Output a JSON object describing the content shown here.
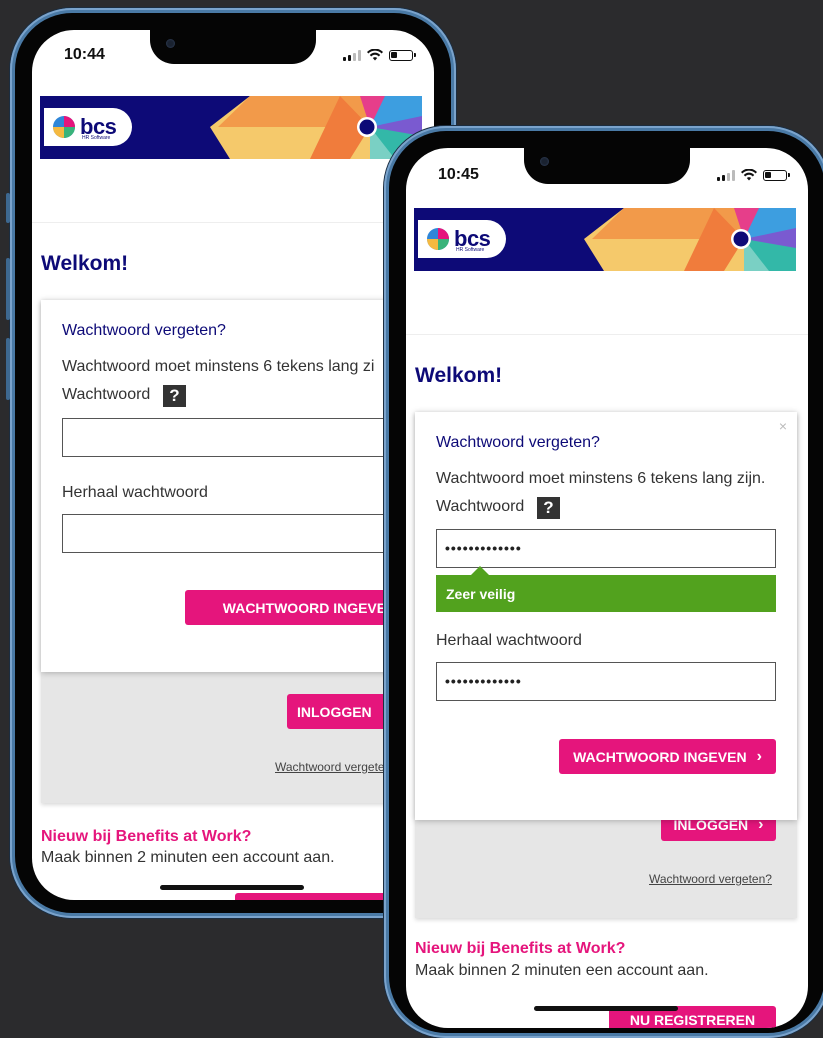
{
  "phone_left": {
    "time": "10:44",
    "welcome": "Welkom!",
    "modal": {
      "forgot_link": "Wachtwoord vergeten?",
      "requirement": "Wachtwoord moet minstens 6 tekens lang zi",
      "password_label": "Wachtwoord",
      "help_icon": "?",
      "password_value": "",
      "repeat_label": "Herhaal wachtwoord",
      "repeat_value": "",
      "submit_label": "WACHTWOORD INGEVEN"
    },
    "login_button": "INLOGGEN",
    "forgot_link_below": "Wachtwoord vergete",
    "new_title": "Nieuw bij Benefits at Work?",
    "new_text": "Maak binnen 2 minuten een account aan."
  },
  "phone_right": {
    "time": "10:45",
    "welcome": "Welkom!",
    "modal": {
      "close_icon": "×",
      "forgot_link": "Wachtwoord vergeten?",
      "requirement": "Wachtwoord moet minstens 6 tekens lang zijn.",
      "password_label": "Wachtwoord",
      "help_icon": "?",
      "password_value": "•••••••••••••",
      "strength_label": "Zeer veilig",
      "repeat_label": "Herhaal wachtwoord",
      "repeat_value": "•••••••••••••",
      "submit_label": "WACHTWOORD INGEVEN",
      "submit_chevron": "›"
    },
    "login_button": "INLOGGEN",
    "login_chevron": "›",
    "forgot_link_below": "Wachtwoord vergeten?",
    "new_title": "Nieuw bij Benefits at Work?",
    "new_text": "Maak binnen 2 minuten een account aan.",
    "register_button": "NU REGISTREREN"
  },
  "brand": {
    "logo_text": "bcs",
    "logo_subtext": "HR Software"
  },
  "colors": {
    "navy": "#0d0a77",
    "pink": "#e5157c",
    "green": "#52a21e",
    "frame": "#4a7aa6"
  }
}
